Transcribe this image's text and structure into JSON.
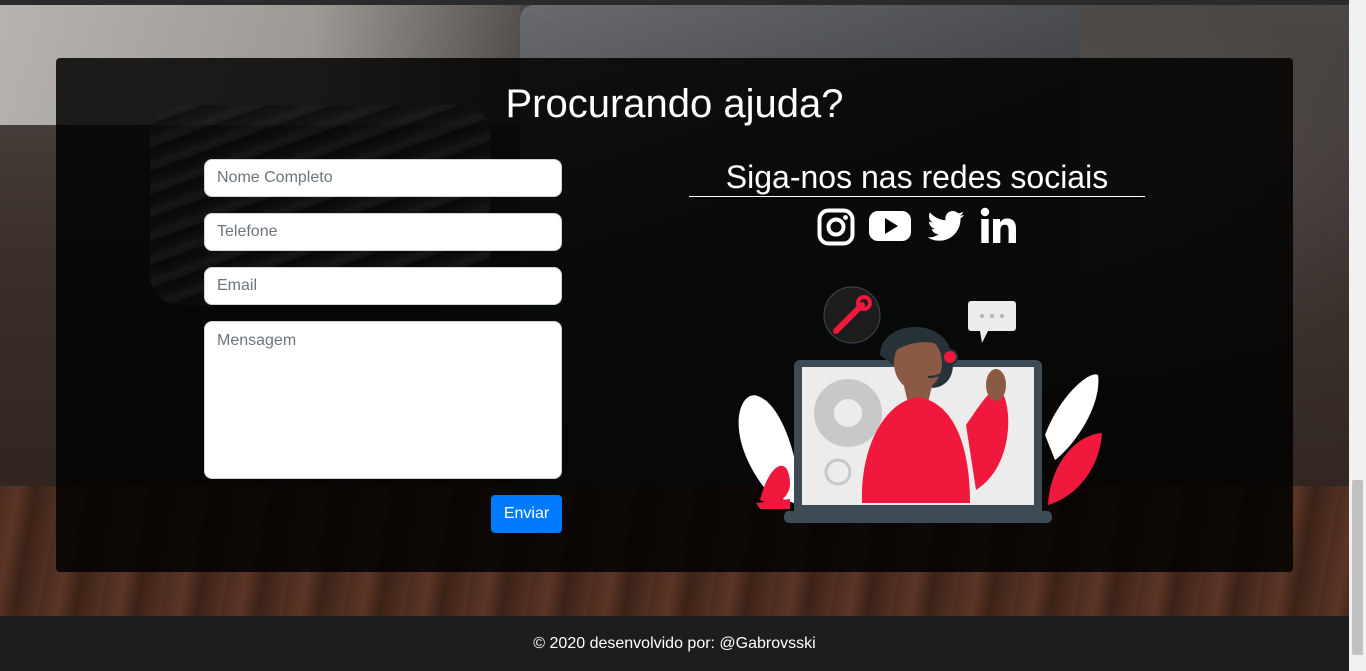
{
  "contact": {
    "title": "Procurando ajuda?",
    "form": {
      "name_placeholder": "Nome Completo",
      "phone_placeholder": "Telefone",
      "email_placeholder": "Email",
      "message_placeholder": "Mensagem",
      "submit_label": "Enviar"
    }
  },
  "social": {
    "title": "Siga-nos nas redes sociais",
    "icons": [
      "instagram-icon",
      "youtube-icon",
      "twitter-icon",
      "linkedin-icon"
    ]
  },
  "footer": {
    "text": "© 2020 desenvolvido por: @Gabrovsski"
  },
  "colors": {
    "button": "#007bff",
    "card_overlay": "#000000",
    "illustration_accent": "#f0183c",
    "footer_bg": "#1d1d1d"
  }
}
